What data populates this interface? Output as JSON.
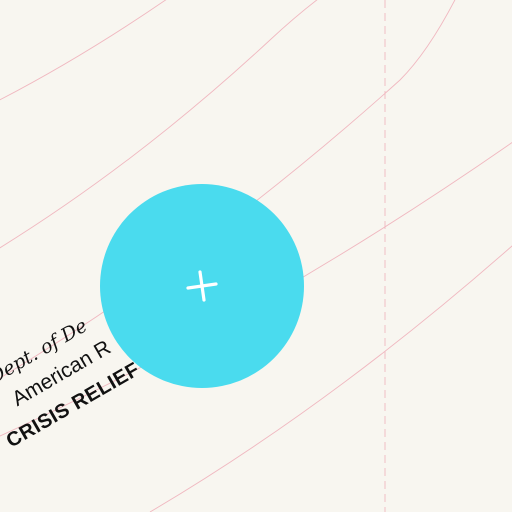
{
  "canvas": {
    "background_color": "#f8f6f0",
    "guide_line_color": "#f0b8c0"
  },
  "labels": {
    "dept": "Dept. of De",
    "org": "American R",
    "crisis": "CRISIS RELIEF"
  },
  "add_button": {
    "icon": "plus-icon",
    "color": "#4adbee",
    "icon_color": "#ffffff"
  }
}
